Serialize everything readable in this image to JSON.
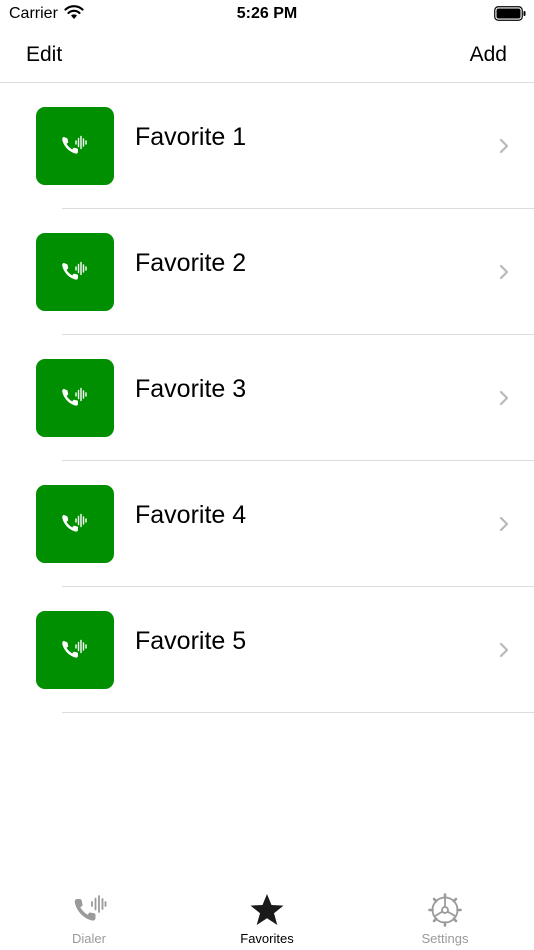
{
  "status_bar": {
    "carrier": "Carrier",
    "time": "5:26 PM"
  },
  "nav": {
    "edit_label": "Edit",
    "add_label": "Add"
  },
  "favorites": [
    {
      "label": "Favorite 1",
      "icon": "phone-waveform-icon"
    },
    {
      "label": "Favorite 2",
      "icon": "phone-waveform-icon"
    },
    {
      "label": "Favorite 3",
      "icon": "phone-waveform-icon"
    },
    {
      "label": "Favorite 4",
      "icon": "phone-waveform-icon"
    },
    {
      "label": "Favorite 5",
      "icon": "phone-waveform-icon"
    }
  ],
  "tabs": [
    {
      "label": "Dialer",
      "icon": "phone-waveform-icon",
      "active": false
    },
    {
      "label": "Favorites",
      "icon": "star-icon",
      "active": true
    },
    {
      "label": "Settings",
      "icon": "gear-icon",
      "active": false
    }
  ],
  "colors": {
    "tile_green": "#008f00",
    "separator": "#dcdcdc",
    "inactive_tab": "#9a9a9a"
  }
}
